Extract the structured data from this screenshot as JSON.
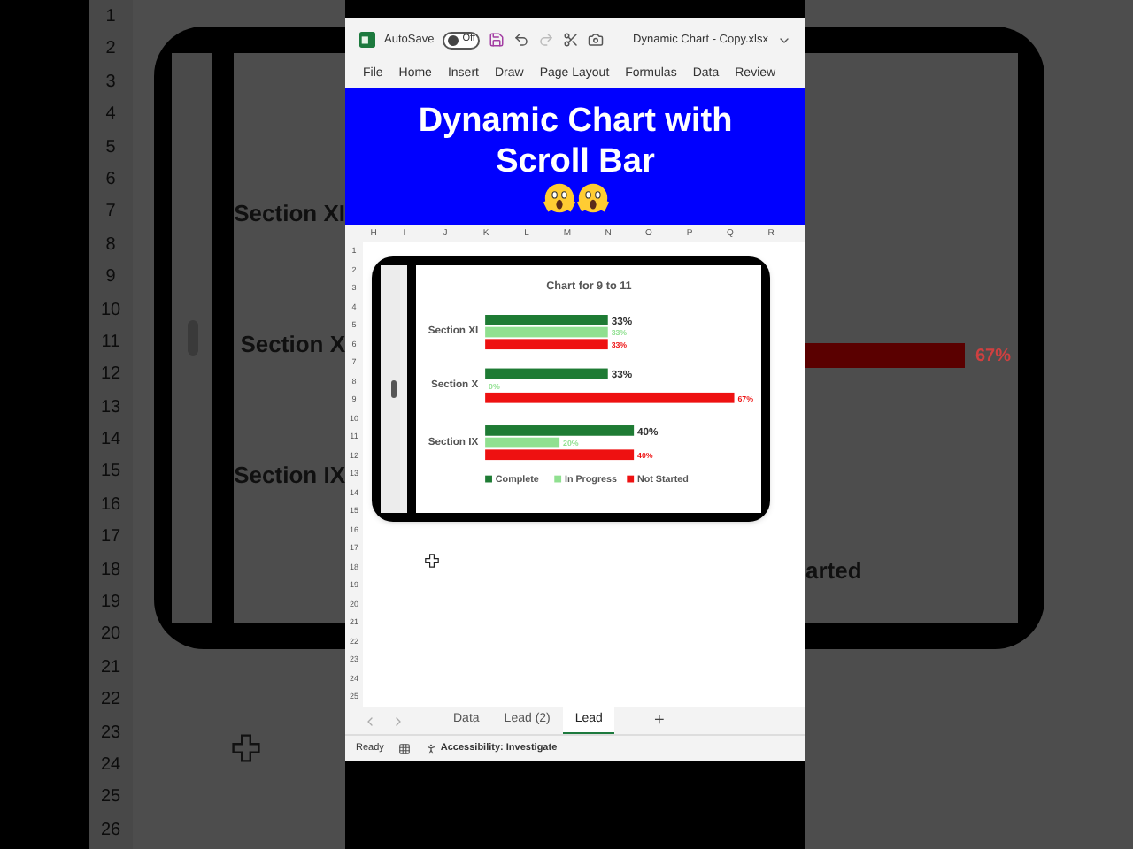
{
  "backdrop": {
    "row_numbers": [
      "1",
      "2",
      "3",
      "4",
      "5",
      "6",
      "7",
      "8",
      "9",
      "10",
      "11",
      "12",
      "13",
      "14",
      "15",
      "16",
      "17",
      "18",
      "19",
      "20",
      "21",
      "22",
      "23",
      "24",
      "25",
      "26"
    ],
    "section_labels": [
      "Section XI",
      "Section X",
      "Section IX"
    ],
    "bar_label": "67%",
    "legend_fragment": "arted"
  },
  "title_bar": {
    "autosave_label": "AutoSave",
    "autosave": {
      "on": false,
      "label": "Off"
    },
    "file_name": "Dynamic Chart - Copy.xlsx"
  },
  "menu": [
    "File",
    "Home",
    "Insert",
    "Draw",
    "Page Layout",
    "Formulas",
    "Data",
    "Review"
  ],
  "banner": {
    "title": "Dynamic Chart with Scroll Bar"
  },
  "sheet": {
    "columns": [
      "H",
      "I",
      "J",
      "K",
      "L",
      "M",
      "N",
      "O",
      "P",
      "Q",
      "R"
    ],
    "rows": [
      "1",
      "2",
      "3",
      "4",
      "5",
      "6",
      "7",
      "8",
      "9",
      "10",
      "11",
      "12",
      "13",
      "14",
      "15",
      "16",
      "17",
      "18",
      "19",
      "20",
      "21",
      "22",
      "23",
      "24",
      "25"
    ],
    "chart": {
      "chart_data": {
        "type": "bar",
        "orientation": "horizontal",
        "title": "Chart for 9 to 11",
        "categories": [
          "Section XI",
          "Section X",
          "Section IX"
        ],
        "series": [
          {
            "name": "Complete",
            "color": "#1e7b34",
            "values": [
              33,
              33,
              40
            ],
            "value_labels": [
              "33%",
              "33%",
              "40%"
            ]
          },
          {
            "name": "In Progress",
            "color": "#90e090",
            "values": [
              33,
              0,
              20
            ],
            "value_labels": [
              "33%",
              "0%",
              "20%"
            ]
          },
          {
            "name": "Not Started",
            "color": "#ee1111",
            "values": [
              33,
              67,
              40
            ],
            "value_labels": [
              "33%",
              "67%",
              "40%"
            ]
          }
        ],
        "data_labels": true,
        "legend": true
      }
    }
  },
  "sheet_tabs": [
    {
      "label": "Data",
      "selected": false
    },
    {
      "label": "Lead (2)",
      "selected": false
    },
    {
      "label": "Lead",
      "selected": true
    }
  ],
  "add_sheet": "+",
  "status_bar": {
    "ready": "Ready",
    "accessibility": "Accessibility: Investigate"
  }
}
